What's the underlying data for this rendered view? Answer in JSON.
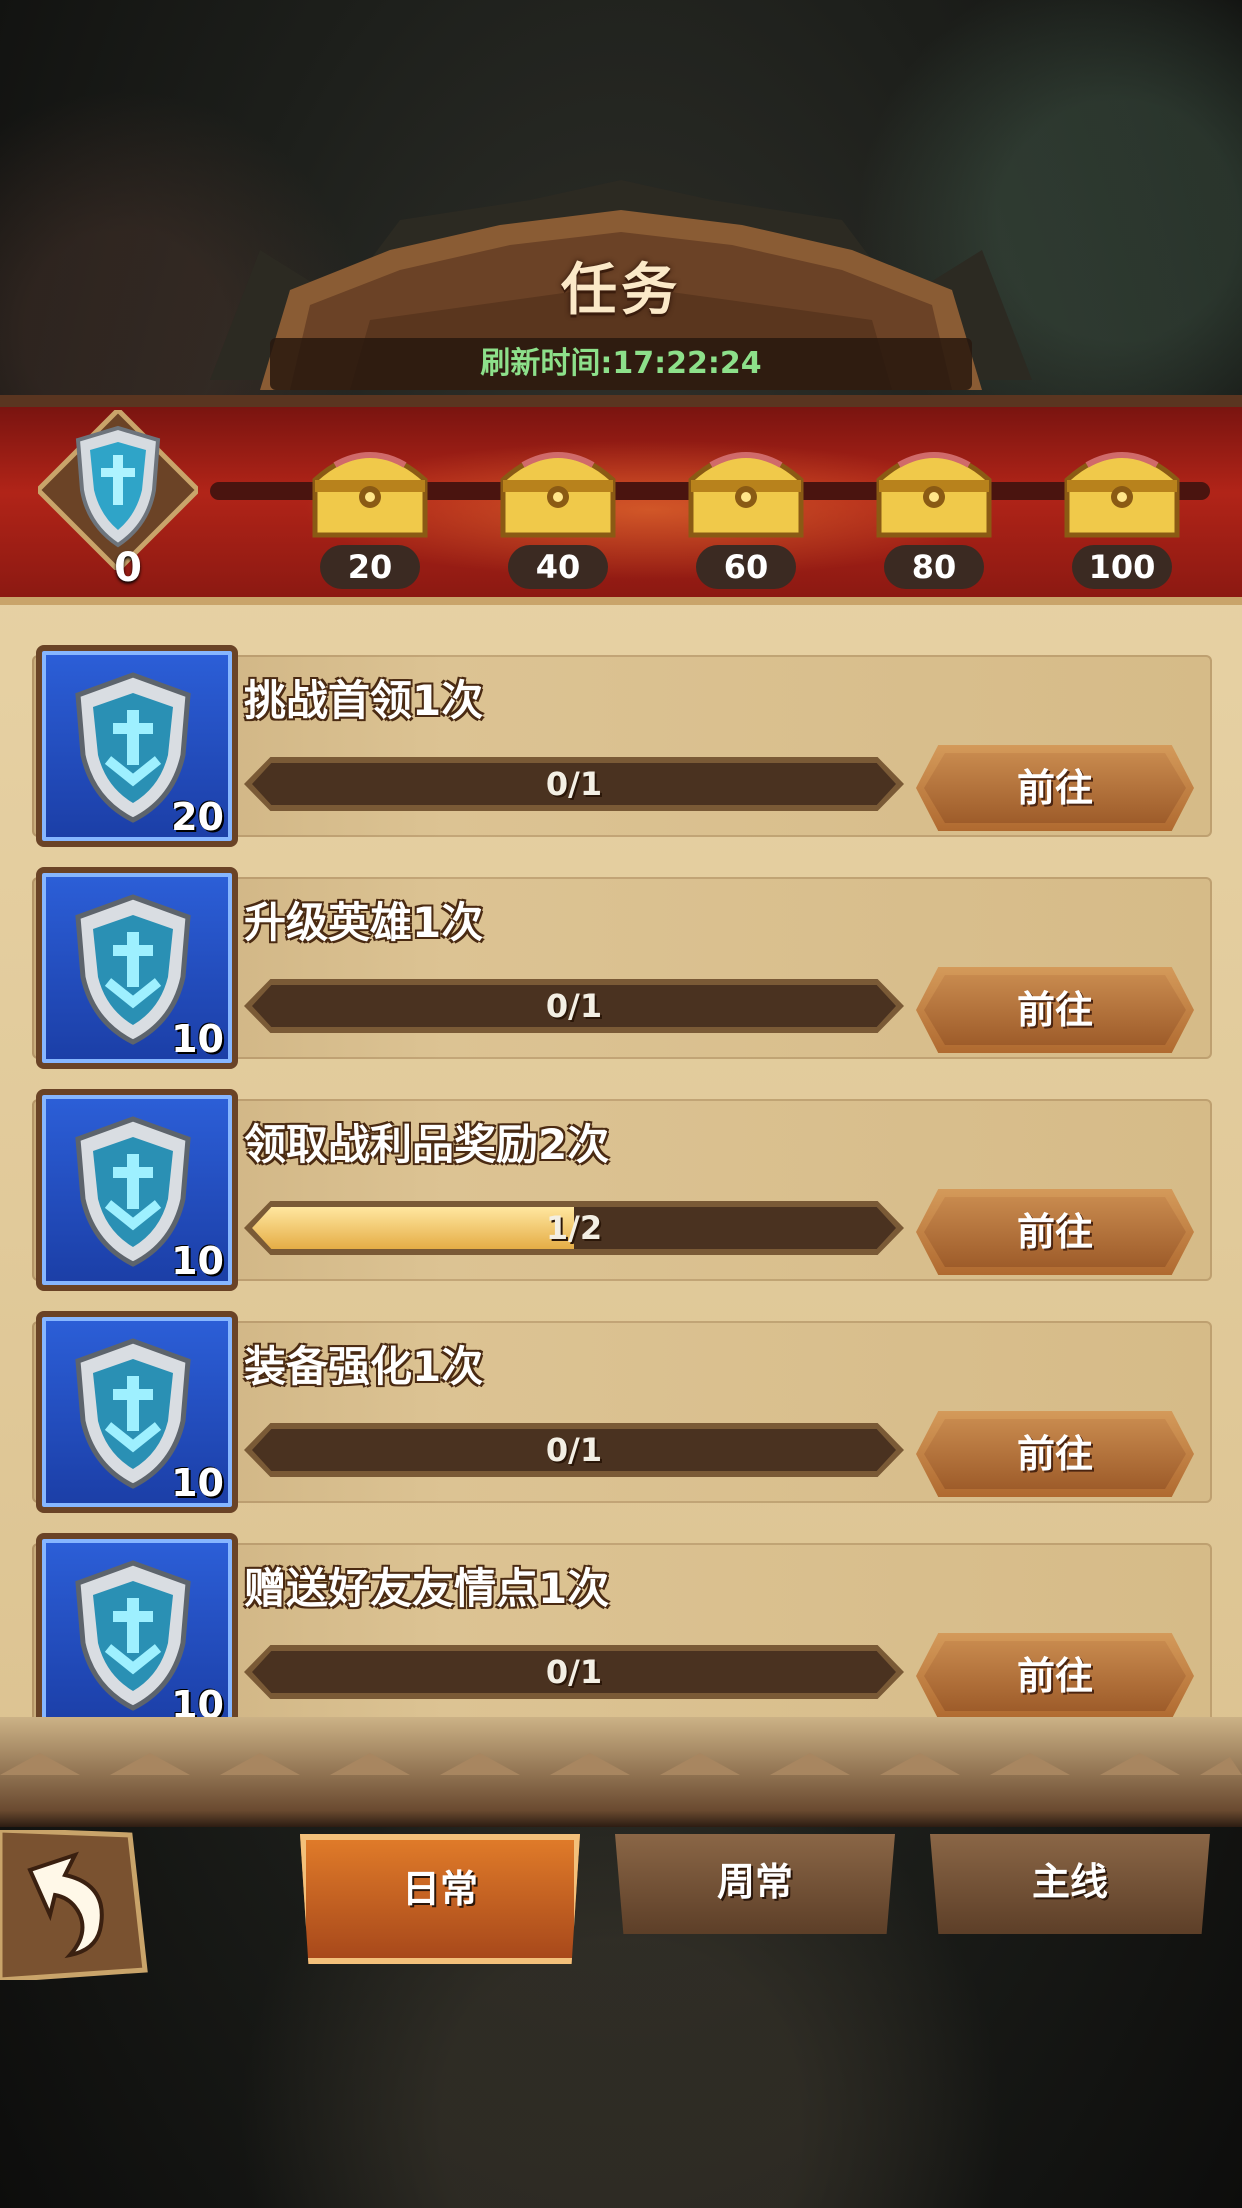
{
  "header": {
    "title": "任务",
    "refresh": "刷新时间:17:22:24"
  },
  "progress": {
    "points": "0",
    "milestones": [
      "20",
      "40",
      "60",
      "80",
      "100"
    ],
    "icon": "blue-shield-icon",
    "chest_icon": "gold-chest-icon"
  },
  "tasks": [
    {
      "name": "挑战首领1次",
      "reward": "20",
      "progress": "0/1",
      "fraction": 0,
      "button": "前往"
    },
    {
      "name": "升级英雄1次",
      "reward": "10",
      "progress": "0/1",
      "fraction": 0,
      "button": "前往"
    },
    {
      "name": "领取战利品奖励2次",
      "reward": "10",
      "progress": "1/2",
      "fraction": 0.5,
      "button": "前往"
    },
    {
      "name": "装备强化1次",
      "reward": "10",
      "progress": "0/1",
      "fraction": 0,
      "button": "前往"
    },
    {
      "name": "赠送好友友情点1次",
      "reward": "10",
      "progress": "0/1",
      "fraction": 0,
      "button": "前往"
    }
  ],
  "tabs": [
    {
      "label": "日常",
      "active": true
    },
    {
      "label": "周常",
      "active": false
    },
    {
      "label": "主线",
      "active": false
    }
  ],
  "colors": {
    "accent": "#c9ad7c",
    "refresh_text": "#8de08a",
    "banner": "#b12418"
  }
}
